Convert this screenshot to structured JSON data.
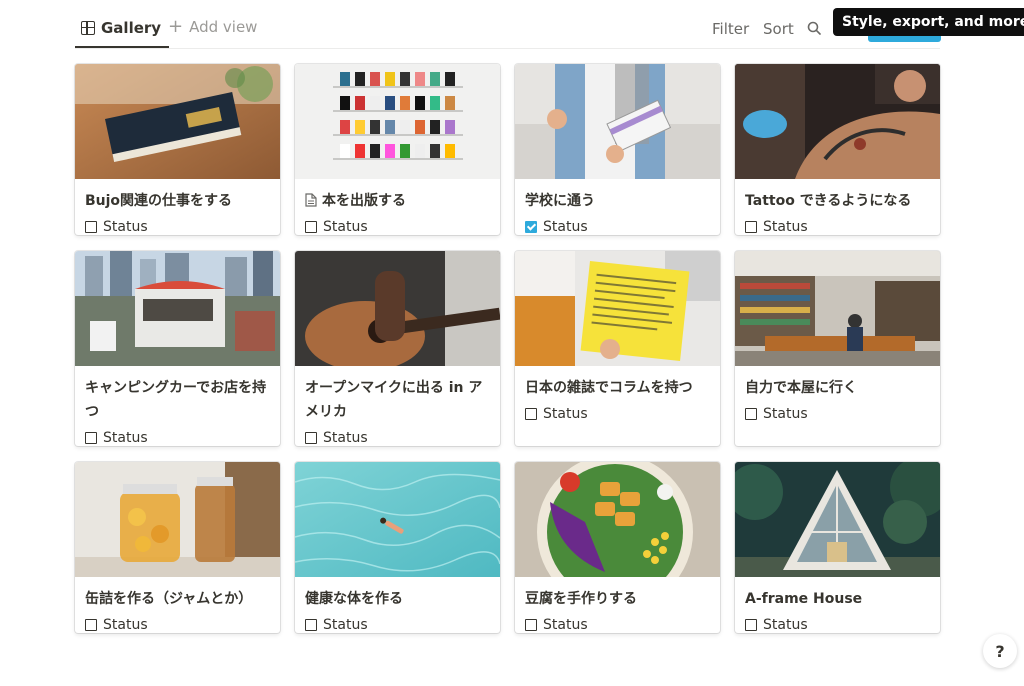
{
  "view_tabs": {
    "gallery_label": "Gallery",
    "add_view_label": "Add view"
  },
  "toolbar": {
    "filter_label": "Filter",
    "sort_label": "Sort",
    "search_icon": "search-icon"
  },
  "tooltip": {
    "text": "Style, export, and more."
  },
  "cards": [
    {
      "title": "Bujo関連の仕事をする",
      "status_label": "Status",
      "checked": false,
      "has_page_icon": false,
      "cover": "book-on-table"
    },
    {
      "title": "本を出版する",
      "status_label": "Status",
      "checked": false,
      "has_page_icon": true,
      "cover": "magazine-shelves"
    },
    {
      "title": "学校に通う",
      "status_label": "Status",
      "checked": true,
      "has_page_icon": false,
      "cover": "student-with-books"
    },
    {
      "title": "Tattoo できるようになる",
      "status_label": "Status",
      "checked": false,
      "has_page_icon": false,
      "cover": "tattoo-artist"
    },
    {
      "title": "キャンピングカーでお店を持つ",
      "status_label": "Status",
      "checked": false,
      "has_page_icon": false,
      "cover": "food-truck-city"
    },
    {
      "title": "オープンマイクに出る in アメリカ",
      "status_label": "Status",
      "checked": false,
      "has_page_icon": false,
      "cover": "acoustic-guitar"
    },
    {
      "title": "日本の雑誌でコラムを持つ",
      "status_label": "Status",
      "checked": false,
      "has_page_icon": false,
      "cover": "yellow-magazine"
    },
    {
      "title": "自力で本屋に行く",
      "status_label": "Status",
      "checked": false,
      "has_page_icon": false,
      "cover": "bookstore-interior"
    },
    {
      "title": "缶詰を作る（ジャムとか）",
      "status_label": "Status",
      "checked": false,
      "has_page_icon": false,
      "cover": "preserve-jars"
    },
    {
      "title": "健康な体を作る",
      "status_label": "Status",
      "checked": false,
      "has_page_icon": false,
      "cover": "swimmer-in-pool"
    },
    {
      "title": "豆腐を手作りする",
      "status_label": "Status",
      "checked": false,
      "has_page_icon": false,
      "cover": "tofu-salad-bowl"
    },
    {
      "title": "A-frame House",
      "status_label": "Status",
      "checked": false,
      "has_page_icon": false,
      "cover": "a-frame-cabin"
    }
  ],
  "help": {
    "label": "?"
  },
  "colors": {
    "accent": "#2eaadc",
    "text": "#37352f",
    "muted": "#9b9a97"
  }
}
